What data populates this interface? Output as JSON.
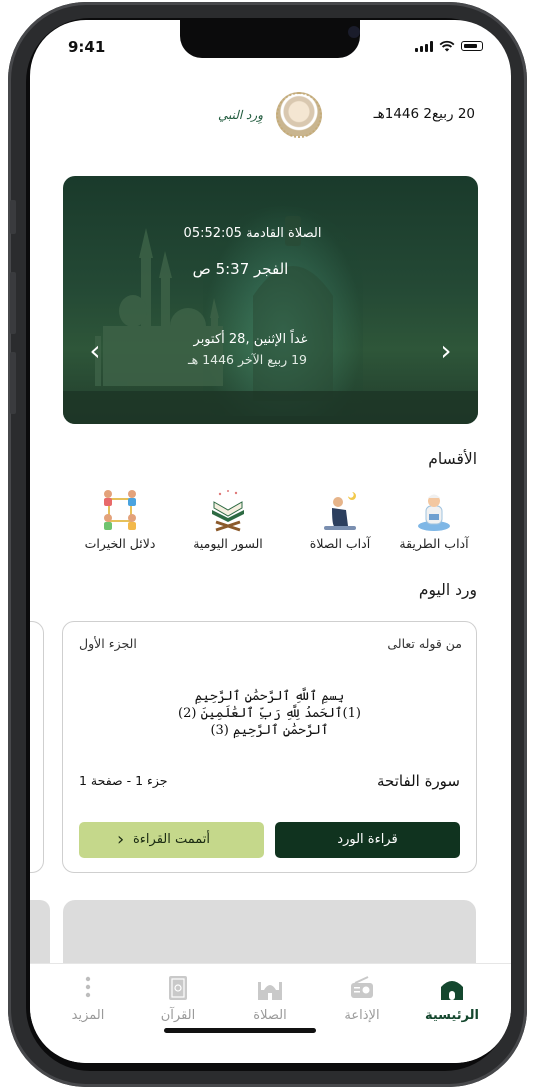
{
  "status": {
    "time": "9:41"
  },
  "header": {
    "date": "20 ربيع2 1446هـ",
    "logo_text": "وِرد النبي"
  },
  "hero": {
    "next_prayer": "الصلاة القادمة 05:52:05",
    "prayer": "الفجر 5:37 ص",
    "gregorian": "غداً الإثنين ,28 أكتوبر",
    "hijri": "19 ربيع الآخر 1446 هـ"
  },
  "sections_title": "الأقسام",
  "categories": [
    {
      "label": "آداب الطريقة",
      "icon": "boy-reading-icon"
    },
    {
      "label": "آداب الصلاة",
      "icon": "praying-man-icon"
    },
    {
      "label": "السور اليومية",
      "icon": "quran-stand-icon"
    },
    {
      "label": "دلائل الخيرات",
      "icon": "people-network-icon"
    }
  ],
  "wird_title": "ورد اليوم",
  "wird": {
    "from": "من قوله تعالى",
    "part": "الجزء الأول",
    "verse1": "بِسمِ ٱللَّهِ ٱلرَّحمَٰنِ ٱلرَّحِيمِ",
    "verse2": "(1)ٱلحَمدُ لِلَّهِ رَبِّ ٱلعَٰلَمِينَ (2)",
    "verse3": "ٱلرَّحمَٰنِ ٱلرَّحِيمِ (3)",
    "sura": "سورة الفاتحة",
    "juz_page": "جزء 1 - صفحة 1",
    "read_button": "قراءة الورد",
    "done_button": "أتممت القراءة"
  },
  "tabs": [
    {
      "label": "الرئيسية",
      "icon": "home-icon",
      "active": true
    },
    {
      "label": "الإذاعة",
      "icon": "radio-icon"
    },
    {
      "label": "الصلاة",
      "icon": "mosque-icon"
    },
    {
      "label": "القرآن",
      "icon": "quran-book-icon"
    },
    {
      "label": "المزيد",
      "icon": "more-dots-icon"
    }
  ],
  "colors": {
    "primary": "#10331f",
    "accent_light": "#c5d88b",
    "active_tab": "#14472e"
  }
}
